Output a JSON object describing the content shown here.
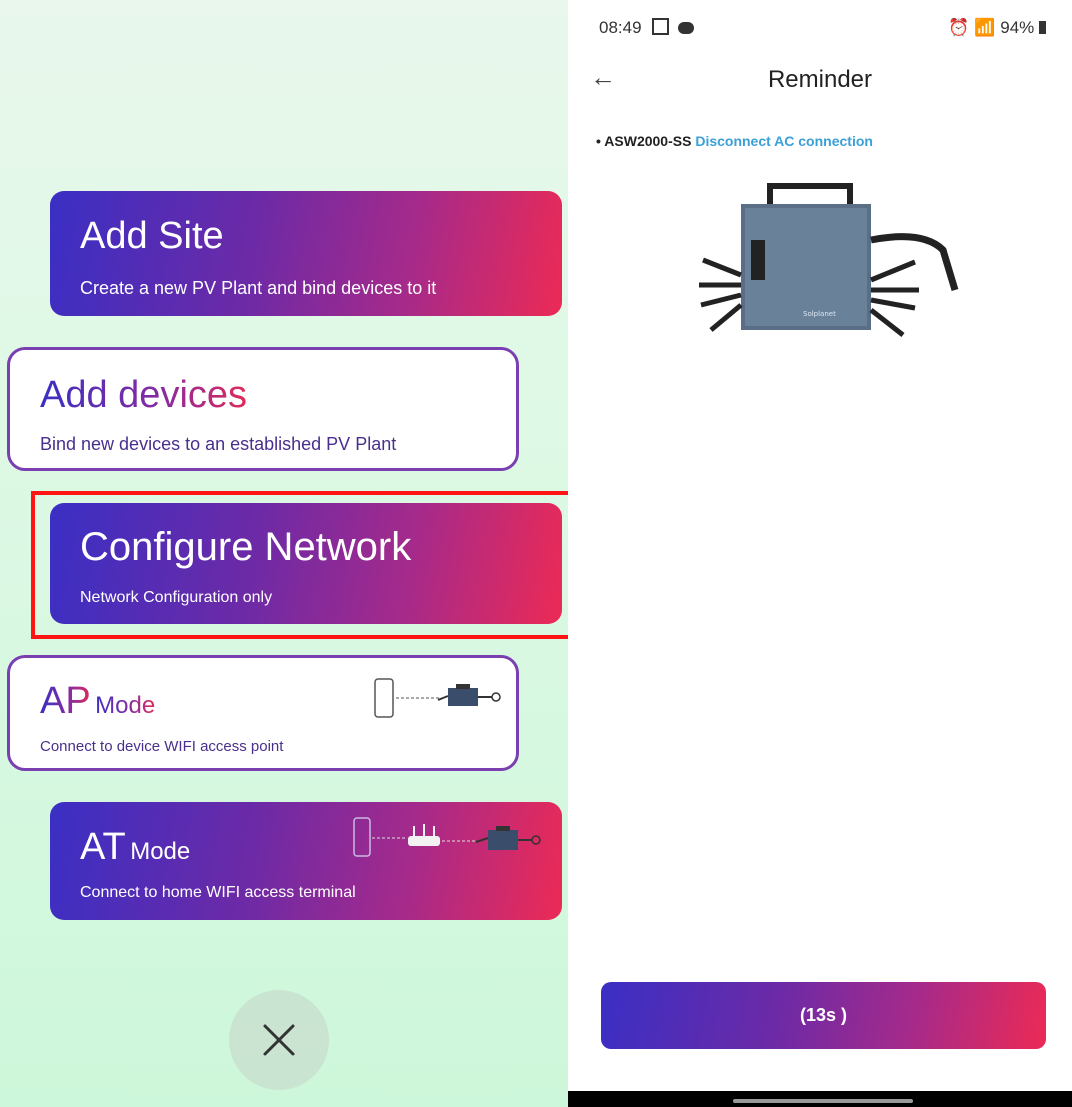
{
  "menu": {
    "add_site": {
      "title": "Add Site",
      "subtitle": "Create a new PV Plant and bind devices to it"
    },
    "add_devices": {
      "title": "Add devices",
      "subtitle": "Bind new devices to an established PV Plant"
    },
    "configure_network": {
      "title": "Configure Network",
      "subtitle": "Network Configuration only"
    },
    "ap_mode": {
      "title_big": "AP",
      "title_small": "Mode",
      "subtitle": "Connect to device WIFI access point"
    },
    "at_mode": {
      "title_big": "AT",
      "title_small": "Mode",
      "subtitle": "Connect to home WIFI access terminal"
    }
  },
  "status_bar": {
    "time": "08:49",
    "battery": "94%"
  },
  "header": {
    "title": "Reminder"
  },
  "reminder": {
    "model": "ASW2000-SS",
    "message": "Disconnect AC connection"
  },
  "device": {
    "brand": "Solplanet"
  },
  "countdown": {
    "label": "(13s )"
  },
  "colors": {
    "gradient_start": "#3a2fc4",
    "gradient_end": "#ec2a55",
    "link": "#3aa0d8",
    "highlight": "#ff1414"
  }
}
